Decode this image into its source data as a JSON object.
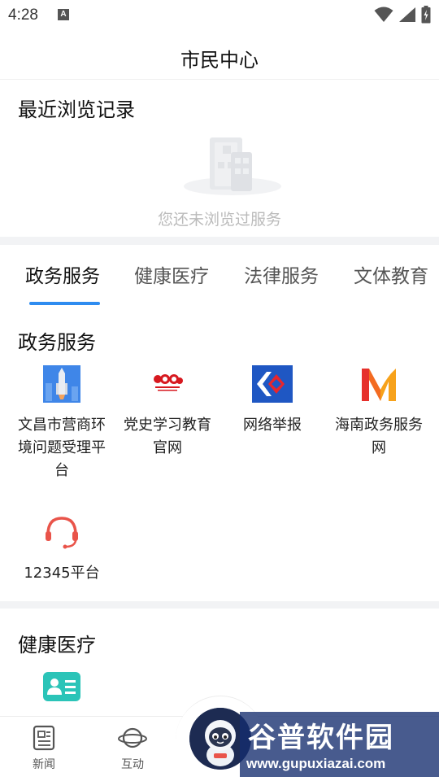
{
  "status_bar": {
    "time": "4:28",
    "notification_letter": "A"
  },
  "header": {
    "title": "市民中心"
  },
  "recent": {
    "title": "最近浏览记录",
    "empty_text": "您还未浏览过服务"
  },
  "tabs": [
    {
      "label": "政务服务",
      "active": true
    },
    {
      "label": "健康医疗",
      "active": false
    },
    {
      "label": "法律服务",
      "active": false
    },
    {
      "label": "文体教育",
      "active": false
    }
  ],
  "gov_section": {
    "title": "政务服务",
    "items": [
      {
        "label": "文昌市营商环境问题受理平台",
        "icon": "rocket-icon"
      },
      {
        "label": "党史学习教育官网",
        "icon": "party-history-icon"
      },
      {
        "label": "网络举报",
        "icon": "report-icon"
      },
      {
        "label": "海南政务服务网",
        "icon": "hainan-gov-icon"
      },
      {
        "label": "12345平台",
        "icon": "headset-icon"
      }
    ]
  },
  "health_section": {
    "title": "健康医疗",
    "items": [
      {
        "icon": "id-card-icon"
      }
    ]
  },
  "bottom_nav": [
    {
      "label": "新闻",
      "icon": "news-icon"
    },
    {
      "label": "互动",
      "icon": "planet-icon"
    }
  ],
  "watermark": {
    "title": "谷普软件园",
    "url": "www.gupuxiazai.com"
  },
  "colors": {
    "accent": "#2e8cf0",
    "health_teal": "#2bc4b8",
    "headset_red": "#e9544a"
  }
}
